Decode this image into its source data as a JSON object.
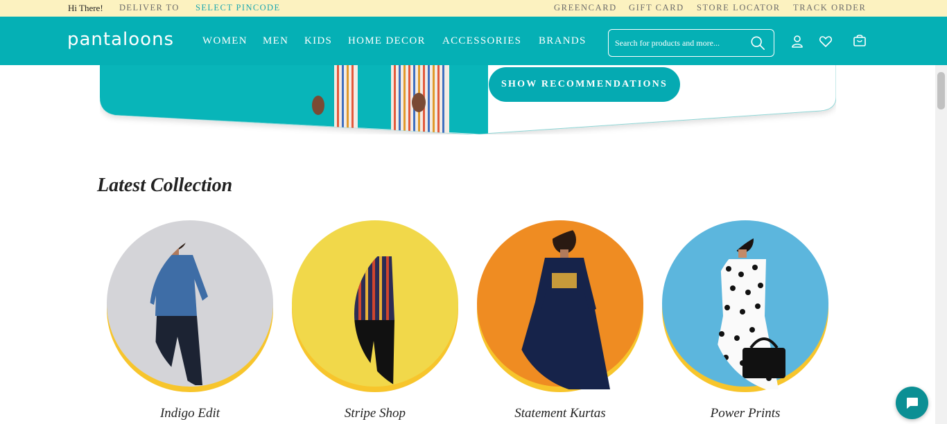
{
  "topbar": {
    "greeting": "Hi There!",
    "deliver_label": "DELIVER TO",
    "pincode_link": "SELECT PINCODE",
    "links": [
      "GREENCARD",
      "GIFT CARD",
      "STORE LOCATOR",
      "TRACK ORDER"
    ]
  },
  "header": {
    "logo": "pantaloons",
    "nav": [
      "WOMEN",
      "MEN",
      "KIDS",
      "HOME DECOR",
      "ACCESSORIES",
      "BRANDS"
    ],
    "search": {
      "placeholder": "Search for products and more...",
      "value": ""
    },
    "icons": [
      "search-icon",
      "user-icon",
      "heart-icon",
      "bag-icon"
    ]
  },
  "banner": {
    "button_label": "SHOW RECOMMENDATIONS"
  },
  "latest": {
    "title": "Latest Collection",
    "items": [
      {
        "label": "Indigo Edit",
        "bg": "#d4d4d8"
      },
      {
        "label": "Stripe Shop",
        "bg": "#f1d84a"
      },
      {
        "label": "Statement Kurtas",
        "bg": "#ef8c22"
      },
      {
        "label": "Power Prints",
        "bg": "#5cb6dd"
      }
    ]
  },
  "colors": {
    "brand_teal": "#05b0b5",
    "top_strip": "#fcf2c0",
    "accent_yellow": "#f7c52c",
    "chat_button": "#0b8f94"
  }
}
